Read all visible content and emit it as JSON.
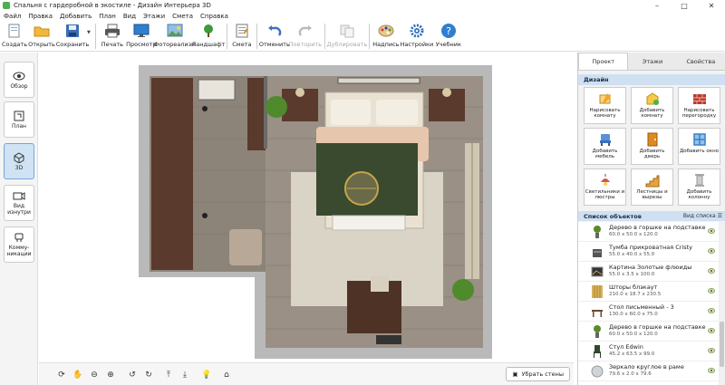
{
  "window": {
    "title": "Спальня с гардеробной в экостиле - Дизайн Интерьера 3D"
  },
  "menu": [
    "Файл",
    "Правка",
    "Добавить",
    "План",
    "Вид",
    "Этажи",
    "Смета",
    "Справка"
  ],
  "toolbar": {
    "create": "Создать",
    "open": "Открыть",
    "save": "Сохранить",
    "print": "Печать",
    "preview": "Просмотр",
    "photoreal": "Фотореализм",
    "landscape": "Ландшафт",
    "estimate": "Смета",
    "undo": "Отменить",
    "redo": "Повторить",
    "duplicate": "Дублировать",
    "label": "Надпись",
    "settings": "Настройки",
    "tutorial": "Учебник"
  },
  "left_nav": [
    {
      "id": "overview",
      "label": "Обзор",
      "icon": "eye-icon"
    },
    {
      "id": "plan",
      "label": "План",
      "icon": "plan-icon"
    },
    {
      "id": "3d",
      "label": "3D",
      "icon": "cube-icon",
      "active": true
    },
    {
      "id": "interior",
      "label": "Вид изнутри",
      "icon": "camera-icon"
    },
    {
      "id": "comms",
      "label": "Комму-никации",
      "icon": "plug-icon"
    }
  ],
  "bottom": {
    "remove_walls": "Убрать стены"
  },
  "right_tabs": [
    "Проект",
    "Этажи",
    "Свойства"
  ],
  "design": {
    "title": "Дизайн",
    "buttons": [
      {
        "label": "Нарисовать комнату",
        "icon": "draw-room-icon",
        "color": "#f5a623"
      },
      {
        "label": "Добавить комнату",
        "icon": "add-room-icon",
        "color": "#f7c948"
      },
      {
        "label": "Нарисовать перегородку",
        "icon": "brick-wall-icon",
        "color": "#c0392b"
      },
      {
        "label": "Добавить мебель",
        "icon": "chair-icon",
        "color": "#5b8fd6"
      },
      {
        "label": "Добавить дверь",
        "icon": "door-icon",
        "color": "#e08a1e"
      },
      {
        "label": "Добавить окно",
        "icon": "window-icon",
        "color": "#3d7fc6"
      },
      {
        "label": "Светильники и люстры",
        "icon": "lamp-icon",
        "color": "#d9534f"
      },
      {
        "label": "Лестницы и вырезы",
        "icon": "stairs-icon",
        "color": "#e8a33b"
      },
      {
        "label": "Добавить колонну",
        "icon": "column-icon",
        "color": "#999999"
      }
    ]
  },
  "objects": {
    "title": "Список объектов",
    "view_label": "Вид списка",
    "items": [
      {
        "name": "Дерево в горшке на подставке",
        "dims": "60.0 x 50.0 x 120.0",
        "icon": "plant-icon"
      },
      {
        "name": "Тумба прикроватная Cristy",
        "dims": "55.0 x 40.0 x 55.0",
        "icon": "nightstand-icon"
      },
      {
        "name": "Картина Золотые флюиды",
        "dims": "55.0 x 3.5 x 100.0",
        "icon": "picture-icon"
      },
      {
        "name": "Шторы блэкаут",
        "dims": "210.0 x 18.7 x 230.5",
        "icon": "curtain-icon"
      },
      {
        "name": "Стол письменный - 3",
        "dims": "130.0 x 60.0 x 75.0",
        "icon": "desk-icon"
      },
      {
        "name": "Дерево в горшке на подставке",
        "dims": "60.0 x 50.0 x 120.0",
        "icon": "plant-icon"
      },
      {
        "name": "Стул Edwin",
        "dims": "45.2 x 63.5 x 99.0",
        "icon": "chair-icon"
      },
      {
        "name": "Зеркало круглое в раме",
        "dims": "79.6 x 2.0 x 79.6",
        "icon": "mirror-icon"
      }
    ]
  },
  "colors": {
    "accent": "#cfe0f2",
    "active_nav": "#cfe3f5",
    "wall": "#b8b8b8",
    "floor": "#8f867c"
  }
}
